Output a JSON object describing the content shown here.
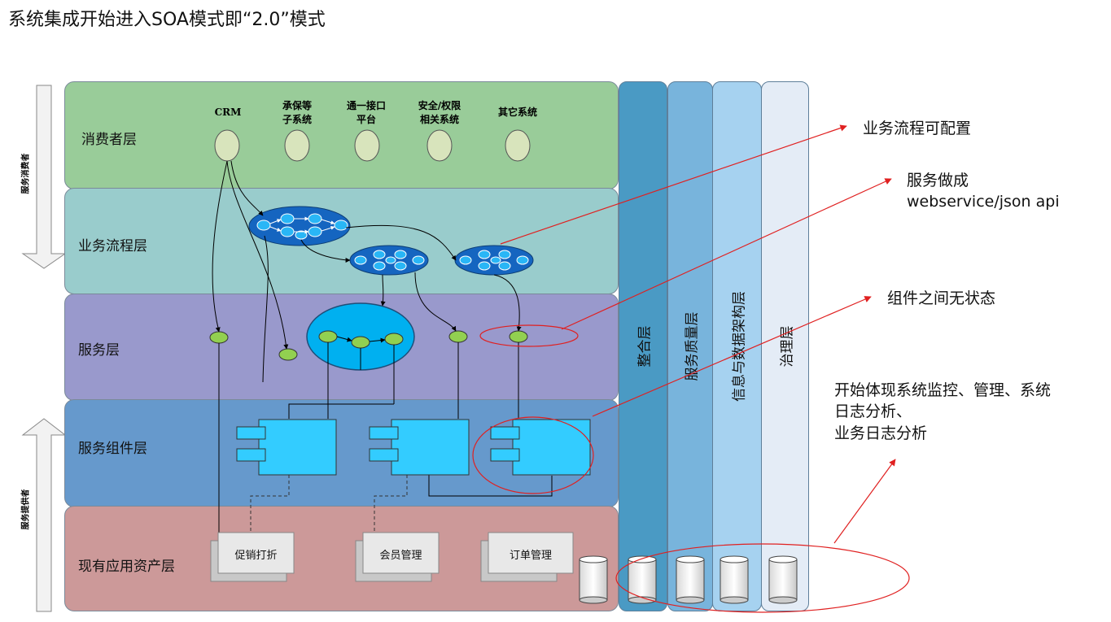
{
  "title": "系统集成开始进入SOA模式即“2.0”模式",
  "layers": {
    "consumer": "消费者层",
    "process": "业务流程层",
    "service": "服务层",
    "component": "服务组件层",
    "asset": "现有应用资产层"
  },
  "consumers": [
    "CRM",
    "承保等\n子系统",
    "通一接口\n平台",
    "安全/权限\n相关系统",
    "其它系统"
  ],
  "columns": [
    "整合层",
    "服务质量层",
    "信息与数据架构层",
    "治理层"
  ],
  "side_labels": {
    "consumer_side": "服务消费者",
    "provider_side": "服务提供者"
  },
  "assets": [
    "促销打折",
    "会员管理",
    "订单管理"
  ],
  "annotations": {
    "configurable": "业务流程可配置",
    "api_line1": "服务做成",
    "api_line2": "webservice/json api",
    "stateless": "组件之间无状态",
    "monitor_line1": "开始体现系统监控、管理、系统",
    "monitor_line2": "日志分析、",
    "monitor_line3": "业务日志分析"
  },
  "colors": {
    "consumer": "#99cc99",
    "process": "#99cccc",
    "service": "#9999cc",
    "component": "#6699cc",
    "asset": "#cc9999",
    "col1": "#4a9ac4",
    "col2": "#78b4dc",
    "col3": "#a6d2f0",
    "col4": "#e4ecf6",
    "annotation": "#e02020"
  }
}
